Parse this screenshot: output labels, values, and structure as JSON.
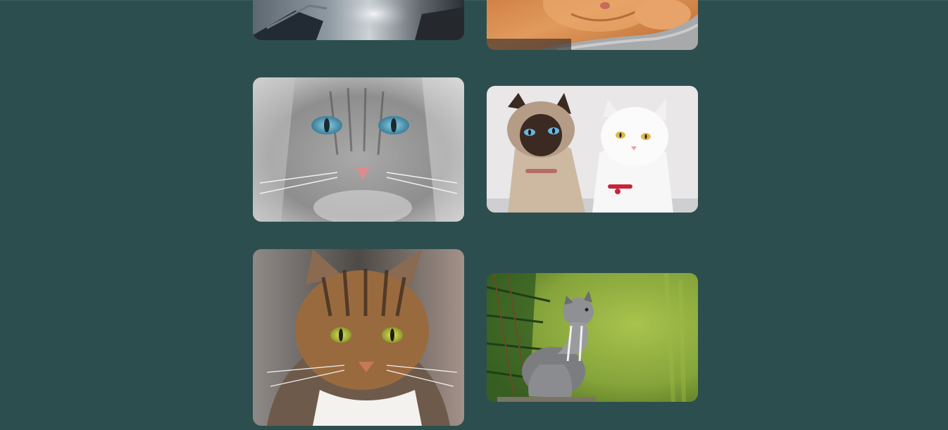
{
  "gallery": {
    "background_color": "#2d4e4e",
    "images": [
      {
        "alt": "",
        "icon": "cat-photo-gray-white-longhair"
      },
      {
        "alt": "",
        "icon": "cat-photo-orange-tabby-on-blanket"
      },
      {
        "alt": "",
        "icon": "cat-photo-gray-longhair-blue-eyes"
      },
      {
        "alt": "",
        "icon": "cat-photo-siamese-and-white-cat"
      },
      {
        "alt": "",
        "icon": "cat-photo-tabby-green-eyes"
      },
      {
        "alt": "",
        "icon": "cat-photo-gray-kitten-in-grass"
      }
    ]
  }
}
